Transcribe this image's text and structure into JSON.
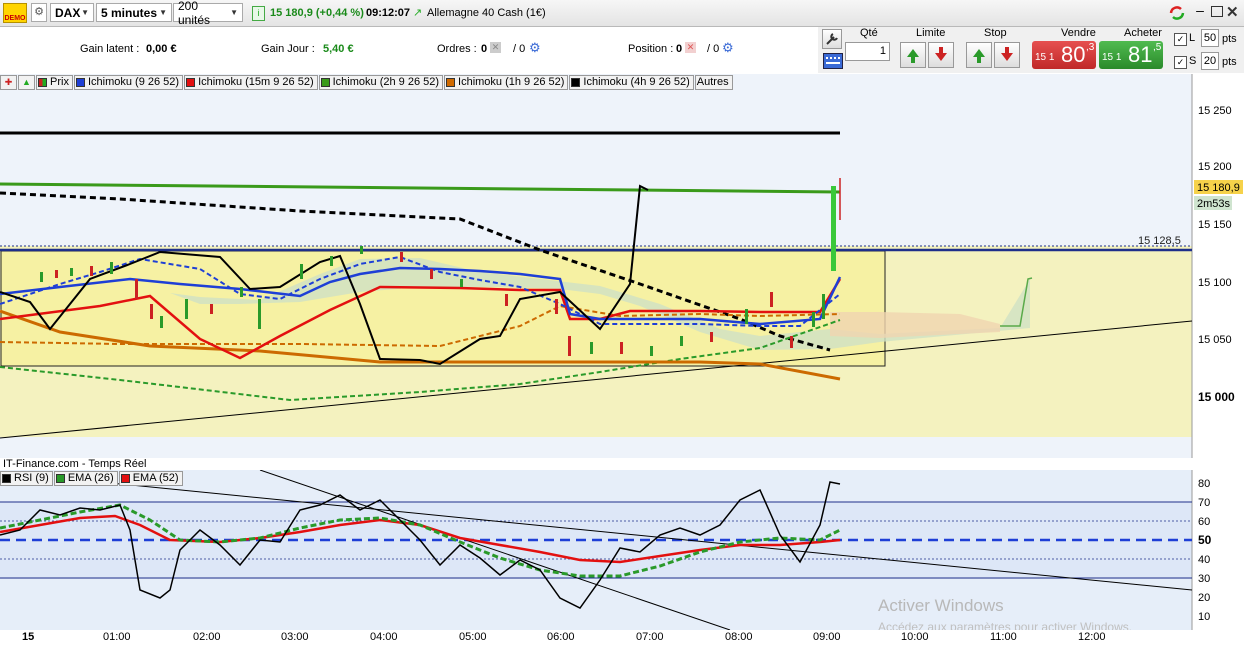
{
  "toolbar": {
    "demo_label": "DEMO",
    "instrument": "DAX",
    "timeframe": "5 minutes",
    "units": "200 unités",
    "quote": "15 180,9 (+0,44 %)",
    "time": "09:12:07",
    "market": "Allemagne 40 Cash (1€)"
  },
  "info": {
    "gain_latent_label": "Gain latent :",
    "gain_latent_value": "0,00 €",
    "gain_jour_label": "Gain Jour :",
    "gain_jour_value": "5,40 €",
    "ordres_label": "Ordres :",
    "ordres_value": "0",
    "ordres_value2": "/ 0",
    "position_label": "Position :",
    "position_value": "0",
    "position_value2": "/ 0"
  },
  "order": {
    "qte_label": "Qté",
    "qte_value": "1",
    "limite_label": "Limite",
    "stop_label": "Stop",
    "vendre_label": "Vendre",
    "vendre_prefix": "15 1",
    "vendre_big": "80",
    "vendre_sup": ",3",
    "acheter_label": "Acheter",
    "acheter_prefix": "15 1",
    "acheter_big": "81",
    "acheter_sup": ",5",
    "l_label": "L",
    "l_value": "50",
    "l_unit": "pts",
    "s_label": "S",
    "s_value": "20",
    "s_unit": "pts"
  },
  "legend_price": {
    "prix": "Prix",
    "ichi1": "Ichimoku (9 26 52)",
    "ichi2": "Ichimoku (15m 9 26 52)",
    "ichi3": "Ichimoku (2h 9 26 52)",
    "ichi4": "Ichimoku (1h 9 26 52)",
    "ichi5": "Ichimoku (4h 9 26 52)",
    "autres": "Autres"
  },
  "price_axis": {
    "ticks": [
      "15 250",
      "15 200",
      "15 150",
      "15 100",
      "15 050",
      "15 000"
    ],
    "current": "15 180,9",
    "countdown": "2m53s",
    "level_label": "15 128,5"
  },
  "source_label": "IT-Finance.com - Temps Réel",
  "legend_rsi": {
    "rsi": "RSI (9)",
    "ema26": "EMA (26)",
    "ema52": "EMA (52)"
  },
  "rsi_axis": {
    "ticks": [
      "80",
      "70",
      "60",
      "50",
      "40",
      "30",
      "20",
      "10"
    ]
  },
  "time_axis": {
    "labels": [
      "15",
      "01:00",
      "02:00",
      "03:00",
      "04:00",
      "05:00",
      "06:00",
      "07:00",
      "08:00",
      "09:00",
      "10:00",
      "11:00",
      "12:00"
    ]
  },
  "watermark": {
    "title": "Activer Windows",
    "subtitle": "Accédez aux paramètres pour activer Windows."
  },
  "colors": {
    "ichi1": "#1e3fd6",
    "ichi2": "#e31010",
    "ichi3": "#3a9a1a",
    "ichi4": "#d06a00",
    "ichi5": "#000000",
    "sell": "#d93b3b",
    "buy": "#3aa83a",
    "chart_bg": "#f0f5fb",
    "zone_yellow": "#f6f3a8"
  },
  "chart_data": [
    {
      "type": "line",
      "title": "DAX 5 minutes",
      "ylim": [
        14966,
        15260
      ],
      "y_ticks": [
        15000,
        15050,
        15100,
        15150,
        15200,
        15250
      ],
      "x_ticks": [
        "15",
        "01:00",
        "02:00",
        "03:00",
        "04:00",
        "05:00",
        "06:00",
        "07:00",
        "08:00",
        "09:00",
        "10:00",
        "11:00",
        "12:00"
      ],
      "current_price": 15180.9,
      "levels": [
        15230,
        15128.5
      ],
      "series": [
        {
          "name": "Prix",
          "x": [
            -1,
            -0.5,
            0,
            0.5,
            1,
            1.5,
            2,
            2.5,
            3,
            3.5,
            4,
            4.5,
            5,
            5.5,
            6,
            6.5,
            7,
            7.5,
            8,
            8.5,
            9,
            9.2
          ],
          "values": [
            15090,
            15105,
            15115,
            15120,
            15080,
            15095,
            15085,
            15105,
            15130,
            15125,
            15120,
            15095,
            15085,
            15080,
            15045,
            15040,
            15055,
            15060,
            15070,
            15080,
            15065,
            15180
          ]
        }
      ]
    },
    {
      "type": "line",
      "ylim": [
        0,
        85
      ],
      "y_ticks": [
        10,
        20,
        30,
        40,
        50,
        60,
        70,
        80
      ],
      "series": [
        {
          "name": "RSI (9)",
          "values": [
            50,
            55,
            65,
            25,
            30,
            50,
            45,
            60,
            55,
            70,
            75,
            55,
            35,
            40,
            15,
            35,
            50,
            55,
            60,
            45,
            70,
            80
          ]
        },
        {
          "name": "EMA (26)",
          "values": [
            52,
            60,
            68,
            55,
            50,
            52,
            55,
            62,
            70,
            65,
            55,
            45,
            35,
            30,
            28,
            35,
            45,
            48,
            50,
            48,
            52,
            55
          ]
        },
        {
          "name": "EMA (52)",
          "values": [
            53,
            58,
            62,
            55,
            52,
            53,
            56,
            60,
            62,
            58,
            50,
            45,
            40,
            39,
            38,
            40,
            45,
            48,
            50,
            47,
            50,
            52
          ]
        }
      ]
    }
  ]
}
